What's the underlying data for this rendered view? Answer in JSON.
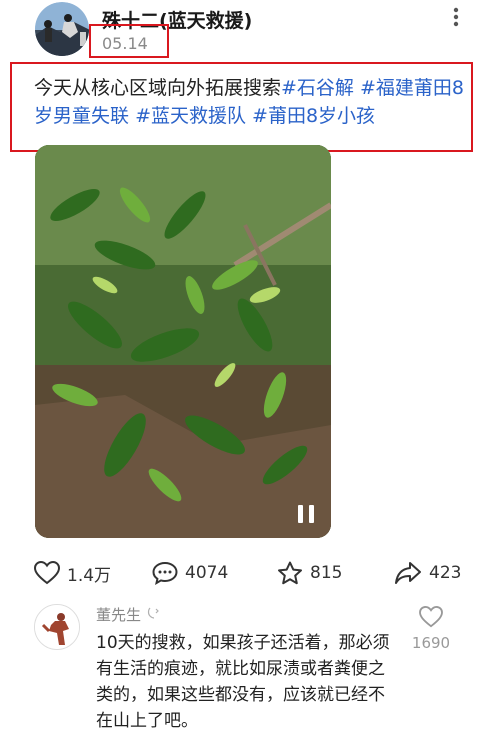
{
  "post": {
    "author": "殊十二(蓝天救援)",
    "date": "05.14",
    "caption_text": "今天从核心区域向外拓展搜索",
    "hashtags": [
      "#石谷解",
      "#福建莆田8岁男童失联",
      "#蓝天救援队",
      "#莆田8岁小孩"
    ]
  },
  "actions": {
    "likes": "1.4万",
    "comments": "4074",
    "favorites": "815",
    "shares": "423"
  },
  "comment": {
    "user": "董先生",
    "text": "10天的搜救，如果孩子还活着，那必须有生活的痕迹，就比如尿渍或者粪便之类的，如果这些都没有，应该就已经不在山上了吧。",
    "likes": "1690"
  },
  "colors": {
    "highlight_box": "#d9181f",
    "hashtag": "#2b63c9"
  },
  "icons": [
    "more-vertical-icon",
    "pause-icon",
    "heart-icon",
    "comment-icon",
    "star-icon",
    "share-icon",
    "user-badge-icon"
  ]
}
